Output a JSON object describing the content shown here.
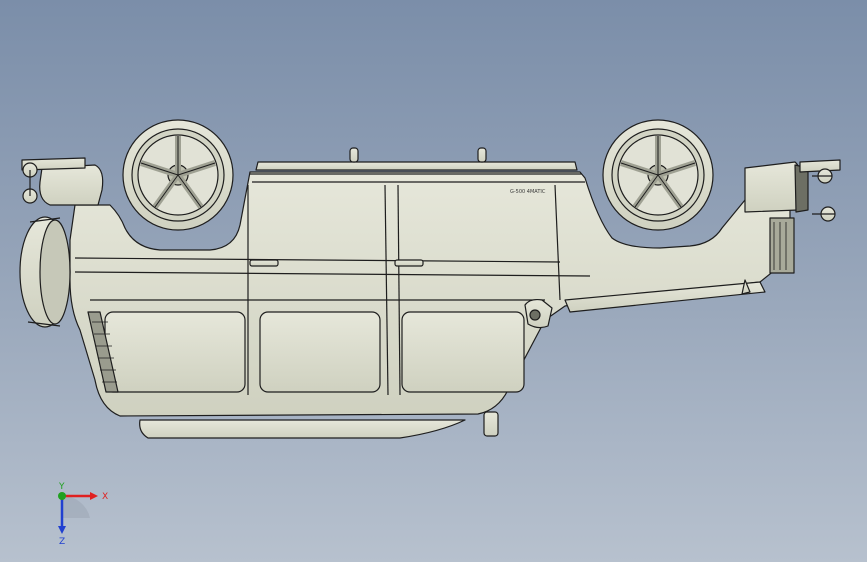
{
  "viewport": {
    "background_top": "#7b8ea9",
    "background_bottom": "#b7c1ce"
  },
  "model": {
    "body_color": "#d9dbcc",
    "line_color": "#1e1e1e",
    "view": "side view, upside down",
    "body_badge": "G-500  4MATIC"
  },
  "triad": {
    "x_label": "X",
    "y_label": "Y",
    "z_label": "Z",
    "x_color": "#e02020",
    "y_color": "#20a020",
    "z_color": "#2040d0"
  }
}
